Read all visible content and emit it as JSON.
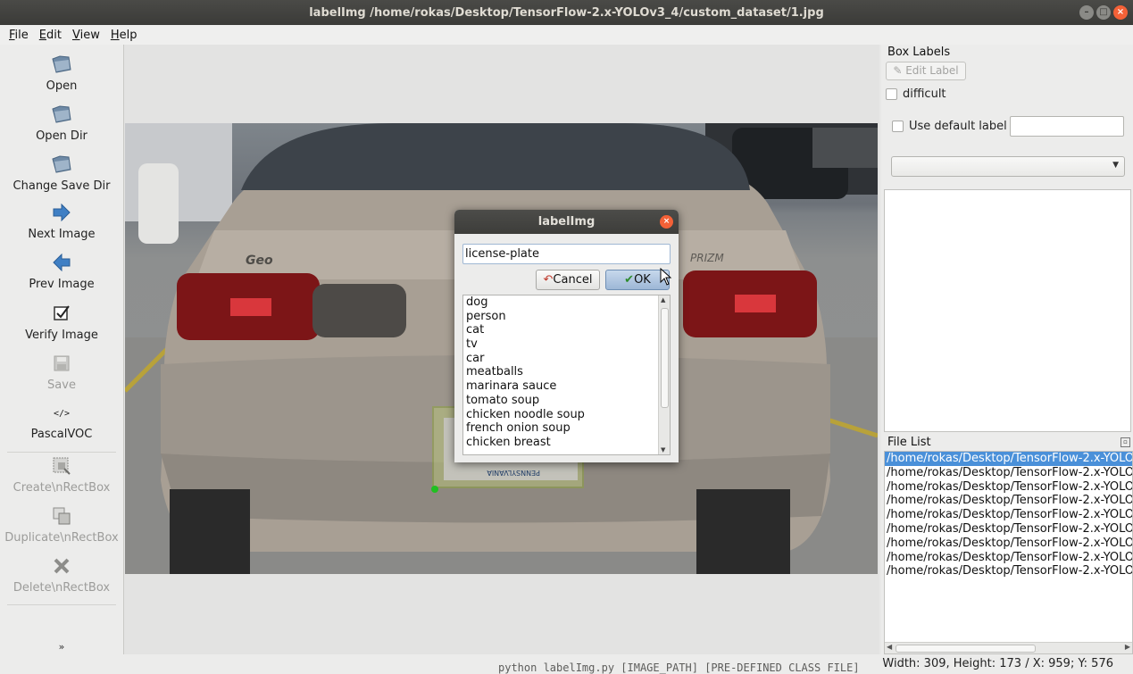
{
  "window": {
    "title": "labelImg /home/rokas/Desktop/TensorFlow-2.x-YOLOv3_4/custom_dataset/1.jpg",
    "controls": [
      "minimize",
      "maximize",
      "close"
    ]
  },
  "menu": [
    {
      "label": "File",
      "accel": "F",
      "rest": "ile"
    },
    {
      "label": "Edit",
      "accel": "E",
      "rest": "dit"
    },
    {
      "label": "View",
      "accel": "V",
      "rest": "iew"
    },
    {
      "label": "Help",
      "accel": "H",
      "rest": "elp"
    }
  ],
  "toolbar": {
    "open": "Open",
    "open_dir": "Open Dir",
    "change_save_dir": "Change Save Dir",
    "next_image": "Next Image",
    "prev_image": "Prev Image",
    "verify_image": "Verify Image",
    "save": "Save",
    "format": "PascalVOC",
    "create_rectbox": "Create\\nRectBox",
    "duplicate_rectbox": "Duplicate\\nRectBox",
    "delete_rectbox": "Delete\\nRectBox",
    "more": "»"
  },
  "right_panel": {
    "box_labels_title": "Box Labels",
    "edit_label_button": "Edit Label",
    "difficult_label": "difficult",
    "use_default_label": "Use default label",
    "default_label_value": "",
    "file_list_title": "File List",
    "files": [
      "/home/rokas/Desktop/TensorFlow-2.x-YOLO",
      "/home/rokas/Desktop/TensorFlow-2.x-YOLO",
      "/home/rokas/Desktop/TensorFlow-2.x-YOLO",
      "/home/rokas/Desktop/TensorFlow-2.x-YOLO",
      "/home/rokas/Desktop/TensorFlow-2.x-YOLO",
      "/home/rokas/Desktop/TensorFlow-2.x-YOLO",
      "/home/rokas/Desktop/TensorFlow-2.x-YOLO",
      "/home/rokas/Desktop/TensorFlow-2.x-YOLO",
      "/home/rokas/Desktop/TensorFlow-2.x-YOLO"
    ],
    "selected_file_index": 0
  },
  "dialog": {
    "title": "labelImg",
    "input_value": "license-plate",
    "cancel_label": "Cancel",
    "ok_label": "OK",
    "labels": [
      "dog",
      "person",
      "cat",
      "tv",
      "car",
      "meatballs",
      "marinara sauce",
      "tomato soup",
      "chicken noodle soup",
      "french onion soup",
      "chicken breast"
    ]
  },
  "image": {
    "car_badge_left": "Geo",
    "car_badge_right": "PRIZM",
    "plate_text": "PENNSYLVANIA"
  },
  "status": {
    "text": "Width: 309, Height: 173 / X: 959; Y: 576",
    "ghost_text": "python labelImg.py [IMAGE_PATH] [PRE-DEFINED CLASS FILE]"
  }
}
